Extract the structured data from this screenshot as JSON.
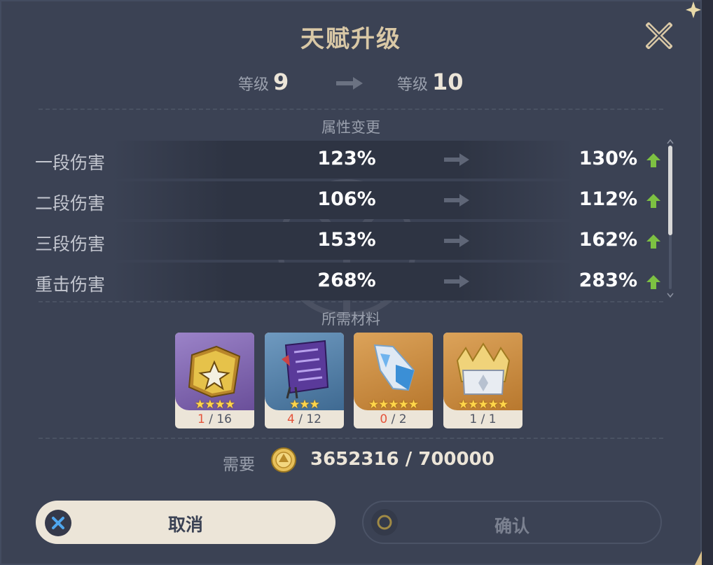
{
  "dialog": {
    "title": "天赋升级"
  },
  "level": {
    "label": "等级",
    "from": "9",
    "to": "10"
  },
  "sections": {
    "stats_title": "属性变更",
    "materials_title": "所需材料"
  },
  "stats": [
    {
      "name": "一段伤害",
      "from": "123%",
      "to": "130%"
    },
    {
      "name": "二段伤害",
      "from": "106%",
      "to": "112%"
    },
    {
      "name": "三段伤害",
      "from": "153%",
      "to": "162%"
    },
    {
      "name": "重击伤害",
      "from": "268%",
      "to": "283%"
    }
  ],
  "materials": [
    {
      "icon": "talent-book-icon",
      "stars": "★★★★",
      "have": "1",
      "need": "/ 16",
      "bg": "#7a5fa8",
      "enough": false
    },
    {
      "icon": "purple-scroll-icon",
      "stars": "★★★",
      "have": "4",
      "need": "/ 12",
      "bg": "#4f7fa6",
      "enough": false
    },
    {
      "icon": "crystal-shard-icon",
      "stars": "★★★★★",
      "have": "0",
      "need": "/ 2",
      "bg": "#c78a3f",
      "enough": false
    },
    {
      "icon": "crown-icon",
      "stars": "★★★★★",
      "have": "1",
      "need": "/ 1",
      "bg": "#c78a3f",
      "enough": true
    }
  ],
  "cost": {
    "label": "需要",
    "value": "3652316 / 700000",
    "icon": "mora-coin-icon"
  },
  "buttons": {
    "cancel": "取消",
    "confirm": "确认"
  },
  "colors": {
    "panel": "#3b4254",
    "title": "#d9c8a6",
    "up_arrow": "#7dc142",
    "deficit": "#e5543b",
    "button_light": "#ece5d8"
  }
}
